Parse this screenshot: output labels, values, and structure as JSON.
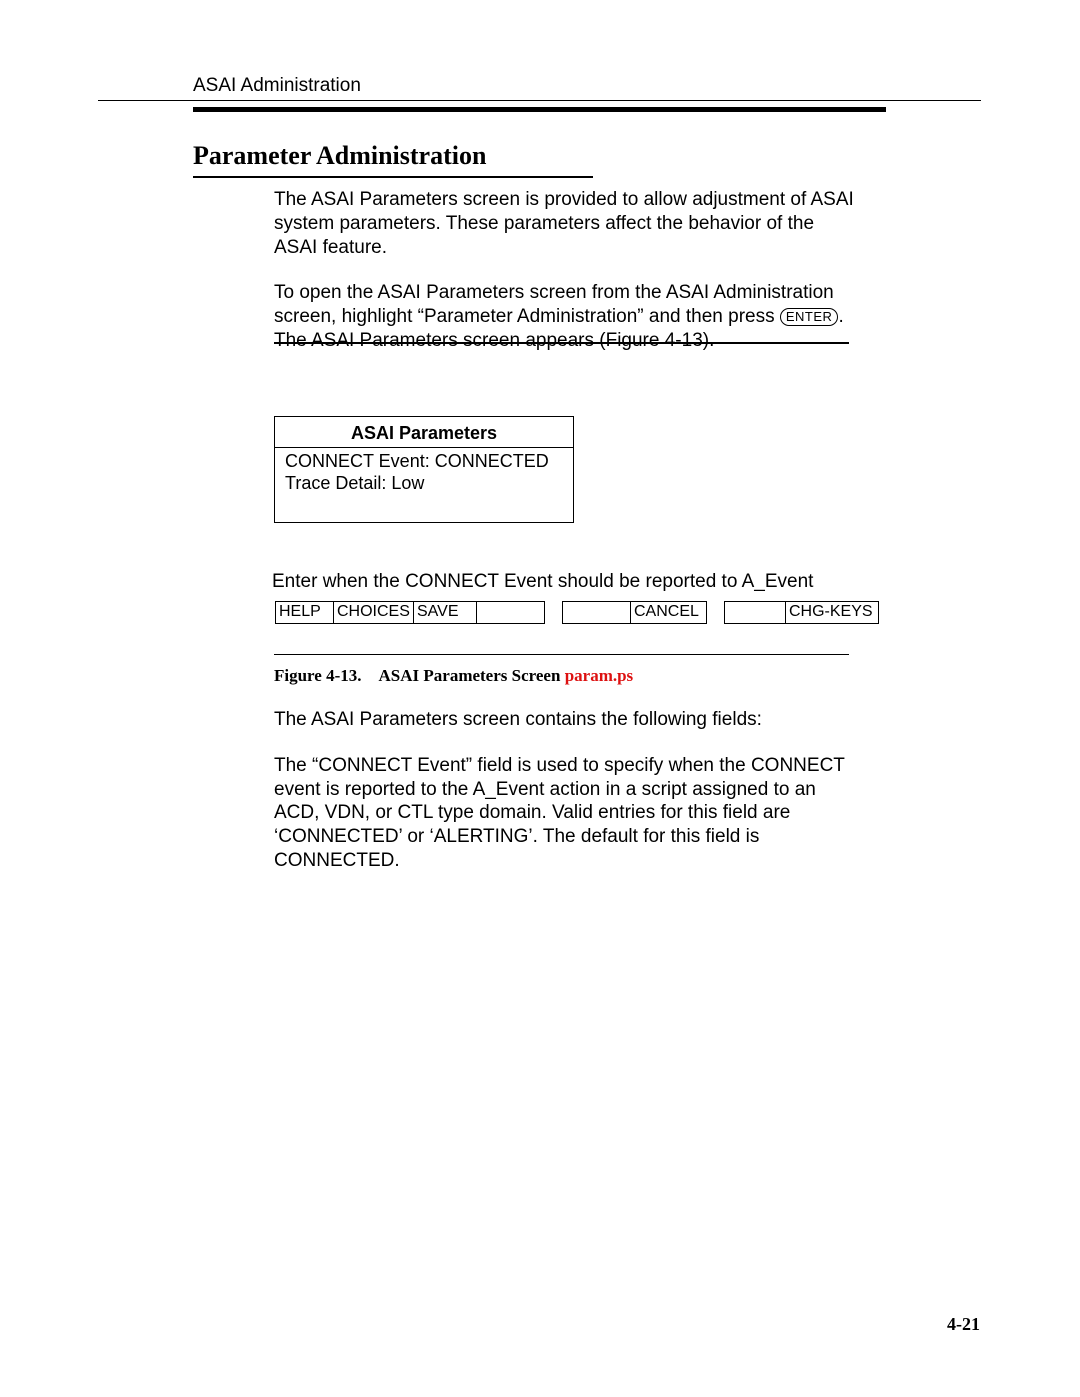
{
  "header": {
    "running": "ASAI Administration"
  },
  "section": {
    "title": "Parameter Administration"
  },
  "paragraphs": {
    "p1": "The ASAI Parameters screen is provided to allow adjustment of ASAI system parameters. These parameters affect the behavior of the ASAI feature.",
    "p2a": "To open the ASAI Parameters screen from the ASAI Administration screen, highlight “Parameter Administration” and then press ",
    "p2_key": "ENTER",
    "p2b": ". The ASAI Parameters screen appears (Figure 4-13).",
    "p3": "The ASAI Parameters screen contains the following fields:",
    "p4": "The “CONNECT Event” field is used to specify when the CONNECT event is reported to the A_Event action in a script assigned to an ACD, VDN, or CTL type domain.  Valid entries for this field are ‘CONNECTED’ or ‘ALERTING’. The default for this field is CONNECTED."
  },
  "param_box": {
    "title": "ASAI Parameters",
    "rows": {
      "r1": "CONNECT Event:  CONNECTED",
      "r2": "Trace Detail:  Low"
    }
  },
  "hint": "Enter when the CONNECT Event should be reported to A_Event",
  "fkeys": {
    "help": "HELP",
    "choices": "CHOICES",
    "save": "SAVE",
    "blank1": "",
    "blank2": "",
    "cancel": "CANCEL",
    "blank3": "",
    "chgkeys": "CHG-KEYS"
  },
  "caption": {
    "label": "Figure 4-13.",
    "title": "ASAI Parameters Screen",
    "link": "param.ps"
  },
  "footer": {
    "page": "4-21"
  }
}
